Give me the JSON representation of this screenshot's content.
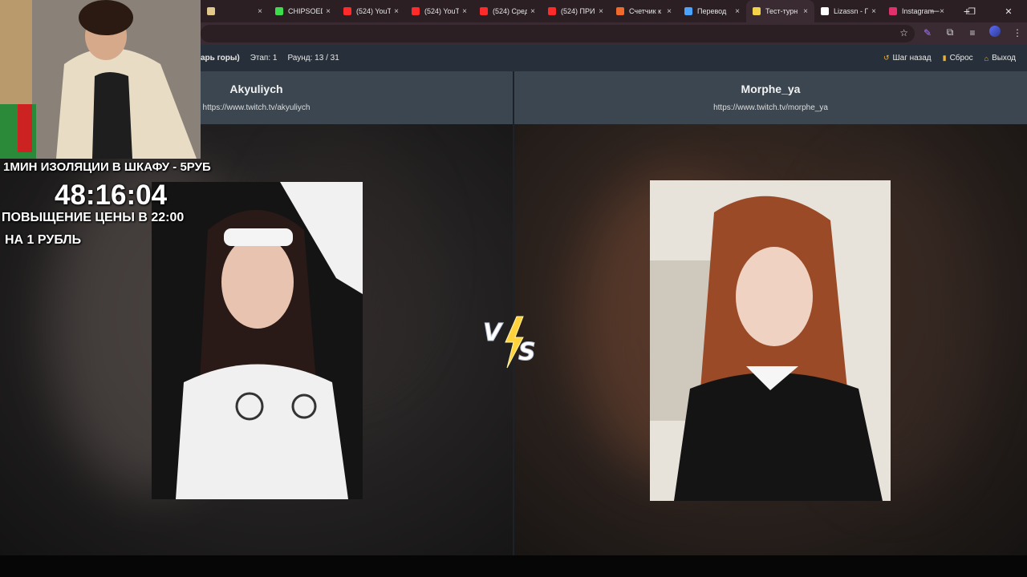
{
  "browser": {
    "tabs": [
      {
        "label": "",
        "favicon_color": "#e0c98a",
        "active": false
      },
      {
        "label": "CHIPSOED",
        "favicon_color": "#3ddc4c",
        "active": false
      },
      {
        "label": "(524) YouT",
        "favicon_color": "#ff2a2a",
        "active": false
      },
      {
        "label": "(524) YouT",
        "favicon_color": "#ff2a2a",
        "active": false
      },
      {
        "label": "(524) Сред",
        "favicon_color": "#ff2a2a",
        "active": false
      },
      {
        "label": "(524) ПРИ",
        "favicon_color": "#ff2a2a",
        "active": false
      },
      {
        "label": "Счетчик к",
        "favicon_color": "#f06a2c",
        "active": false
      },
      {
        "label": "Перевод",
        "favicon_color": "#4aa3ff",
        "active": false
      },
      {
        "label": "Тест-турн",
        "favicon_color": "#f2d24a",
        "active": true
      },
      {
        "label": "Lizassn - Г",
        "favicon_color": "#ffffff",
        "active": false
      },
      {
        "label": "Instagram",
        "favicon_color": "#e1306c",
        "active": false
      }
    ],
    "close_glyph": "×",
    "new_tab_glyph": "+",
    "star_glyph": "☆"
  },
  "header": {
    "mode": "арь горы)",
    "stage": "Этап: 1",
    "round": "Раунд: 13 / 31",
    "step_back": "Шаг назад",
    "reset": "Сброс",
    "exit": "Выход"
  },
  "left": {
    "name": "Akyuliych",
    "url": "https://www.twitch.tv/akyuliych"
  },
  "right": {
    "name": "Morphe_ya",
    "url": "https://www.twitch.tv/morphe_ya"
  },
  "overlay": {
    "line1": "1МИН ИЗОЛЯЦИИ В ШКАФУ - 5РУБ",
    "timer": "48:16:04",
    "line3": "ПОВЫЩЕНИЕ ЦЕНЫ В 22:00",
    "line4": "НА 1 РУБЛЬ"
  },
  "vs_logo": {
    "letter_v": "V",
    "letter_s": "S"
  }
}
